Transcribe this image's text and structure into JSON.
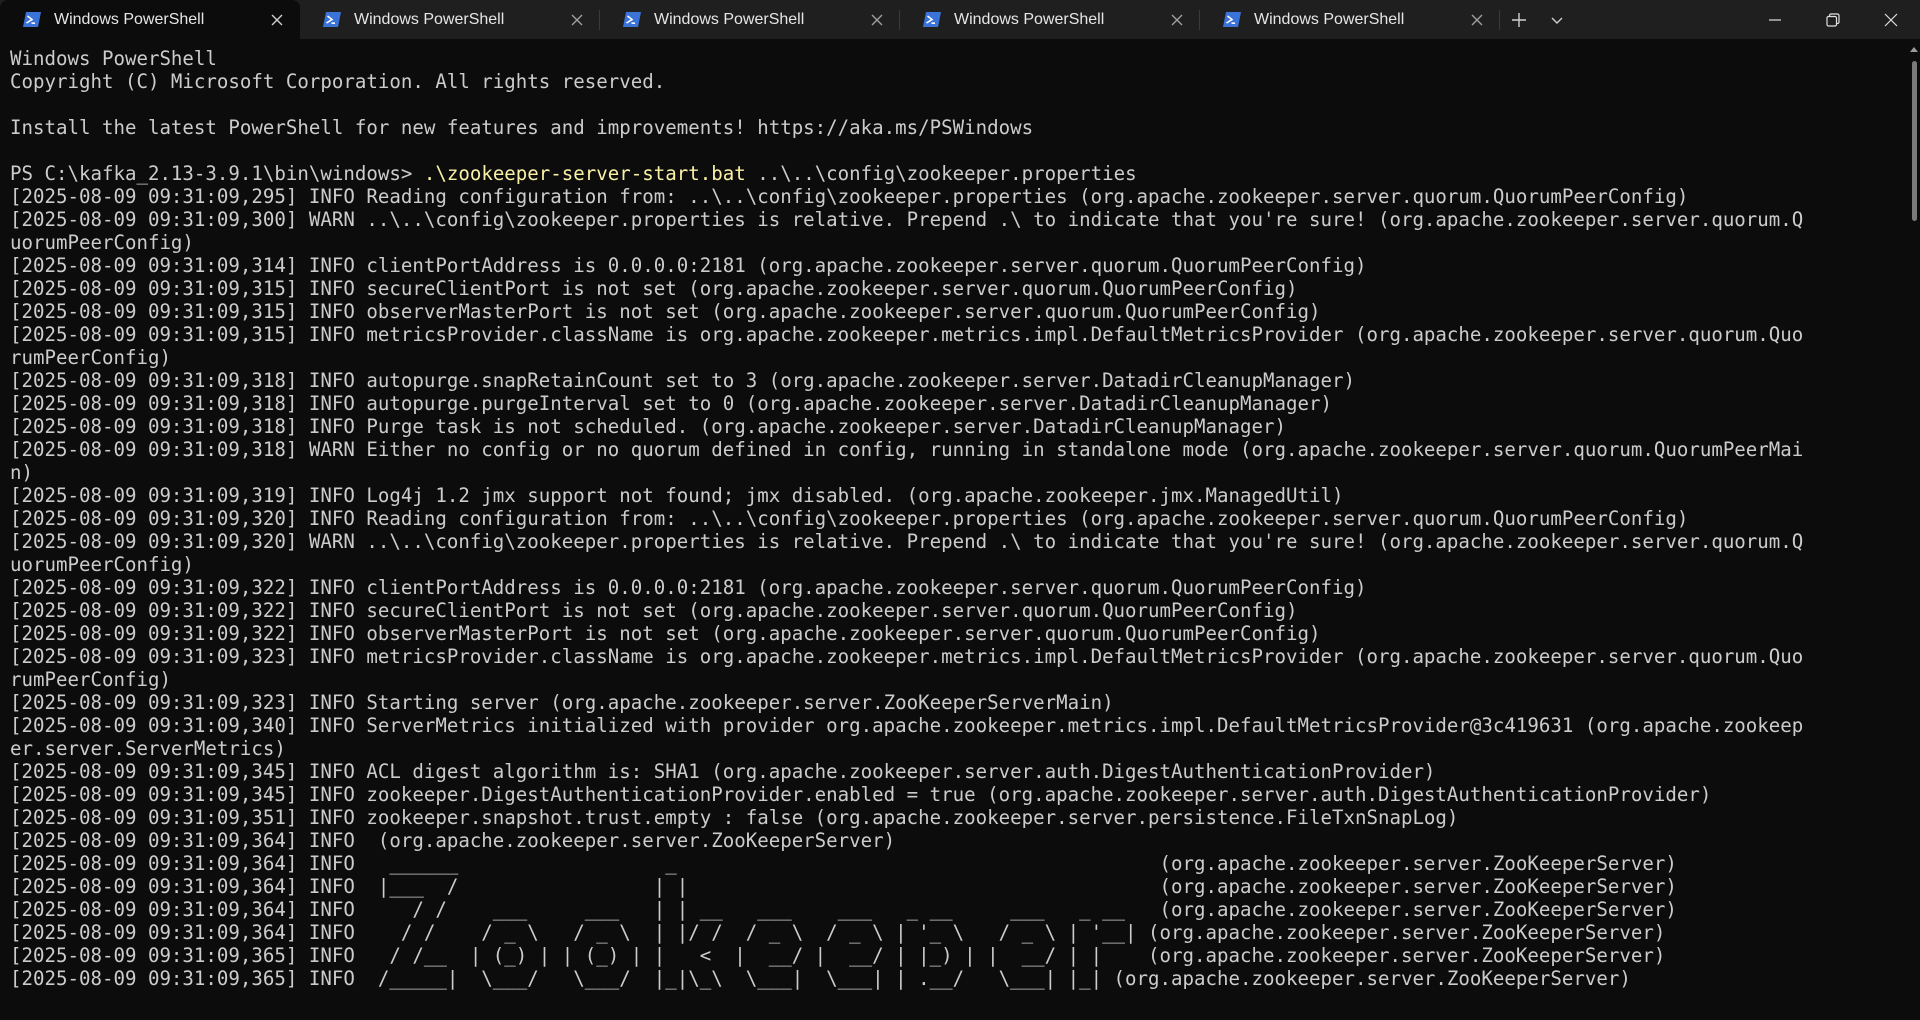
{
  "tabs": [
    {
      "label": "Windows PowerShell",
      "active": true
    },
    {
      "label": "Windows PowerShell",
      "active": false
    },
    {
      "label": "Windows PowerShell",
      "active": false
    },
    {
      "label": "Windows PowerShell",
      "active": false
    },
    {
      "label": "Windows PowerShell",
      "active": false
    }
  ],
  "colors": {
    "background": "#0c0c0c",
    "text": "#cccccc",
    "command": "#f9f1a5",
    "tabbar": "#1f1f1f"
  },
  "terminal": {
    "lines": [
      {
        "text": "Windows PowerShell"
      },
      {
        "text": "Copyright (C) Microsoft Corporation. All rights reserved."
      },
      {
        "text": ""
      },
      {
        "text": "Install the latest PowerShell for new features and improvements! https://aka.ms/PSWindows"
      },
      {
        "text": ""
      },
      {
        "prompt": "PS C:\\kafka_2.13-3.9.1\\bin\\windows> ",
        "command": ".\\zookeeper-server-start.bat",
        "args": " ..\\..\\config\\zookeeper.properties"
      },
      {
        "text": "[2025-08-09 09:31:09,295] INFO Reading configuration from: ..\\..\\config\\zookeeper.properties (org.apache.zookeeper.server.quorum.QuorumPeerConfig)"
      },
      {
        "text": "[2025-08-09 09:31:09,300] WARN ..\\..\\config\\zookeeper.properties is relative. Prepend .\\ to indicate that you're sure! (org.apache.zookeeper.server.quorum.Q"
      },
      {
        "text": "uorumPeerConfig)"
      },
      {
        "text": "[2025-08-09 09:31:09,314] INFO clientPortAddress is 0.0.0.0:2181 (org.apache.zookeeper.server.quorum.QuorumPeerConfig)"
      },
      {
        "text": "[2025-08-09 09:31:09,315] INFO secureClientPort is not set (org.apache.zookeeper.server.quorum.QuorumPeerConfig)"
      },
      {
        "text": "[2025-08-09 09:31:09,315] INFO observerMasterPort is not set (org.apache.zookeeper.server.quorum.QuorumPeerConfig)"
      },
      {
        "text": "[2025-08-09 09:31:09,315] INFO metricsProvider.className is org.apache.zookeeper.metrics.impl.DefaultMetricsProvider (org.apache.zookeeper.server.quorum.Quo"
      },
      {
        "text": "rumPeerConfig)"
      },
      {
        "text": "[2025-08-09 09:31:09,318] INFO autopurge.snapRetainCount set to 3 (org.apache.zookeeper.server.DatadirCleanupManager)"
      },
      {
        "text": "[2025-08-09 09:31:09,318] INFO autopurge.purgeInterval set to 0 (org.apache.zookeeper.server.DatadirCleanupManager)"
      },
      {
        "text": "[2025-08-09 09:31:09,318] INFO Purge task is not scheduled. (org.apache.zookeeper.server.DatadirCleanupManager)"
      },
      {
        "text": "[2025-08-09 09:31:09,318] WARN Either no config or no quorum defined in config, running in standalone mode (org.apache.zookeeper.server.quorum.QuorumPeerMai"
      },
      {
        "text": "n)"
      },
      {
        "text": "[2025-08-09 09:31:09,319] INFO Log4j 1.2 jmx support not found; jmx disabled. (org.apache.zookeeper.jmx.ManagedUtil)"
      },
      {
        "text": "[2025-08-09 09:31:09,320] INFO Reading configuration from: ..\\..\\config\\zookeeper.properties (org.apache.zookeeper.server.quorum.QuorumPeerConfig)"
      },
      {
        "text": "[2025-08-09 09:31:09,320] WARN ..\\..\\config\\zookeeper.properties is relative. Prepend .\\ to indicate that you're sure! (org.apache.zookeeper.server.quorum.Q"
      },
      {
        "text": "uorumPeerConfig)"
      },
      {
        "text": "[2025-08-09 09:31:09,322] INFO clientPortAddress is 0.0.0.0:2181 (org.apache.zookeeper.server.quorum.QuorumPeerConfig)"
      },
      {
        "text": "[2025-08-09 09:31:09,322] INFO secureClientPort is not set (org.apache.zookeeper.server.quorum.QuorumPeerConfig)"
      },
      {
        "text": "[2025-08-09 09:31:09,322] INFO observerMasterPort is not set (org.apache.zookeeper.server.quorum.QuorumPeerConfig)"
      },
      {
        "text": "[2025-08-09 09:31:09,323] INFO metricsProvider.className is org.apache.zookeeper.metrics.impl.DefaultMetricsProvider (org.apache.zookeeper.server.quorum.Quo"
      },
      {
        "text": "rumPeerConfig)"
      },
      {
        "text": "[2025-08-09 09:31:09,323] INFO Starting server (org.apache.zookeeper.server.ZooKeeperServerMain)"
      },
      {
        "text": "[2025-08-09 09:31:09,340] INFO ServerMetrics initialized with provider org.apache.zookeeper.metrics.impl.DefaultMetricsProvider@3c419631 (org.apache.zookeep"
      },
      {
        "text": "er.server.ServerMetrics)"
      },
      {
        "text": "[2025-08-09 09:31:09,345] INFO ACL digest algorithm is: SHA1 (org.apache.zookeeper.server.auth.DigestAuthenticationProvider)"
      },
      {
        "text": "[2025-08-09 09:31:09,345] INFO zookeeper.DigestAuthenticationProvider.enabled = true (org.apache.zookeeper.server.auth.DigestAuthenticationProvider)"
      },
      {
        "text": "[2025-08-09 09:31:09,351] INFO zookeeper.snapshot.trust.empty : false (org.apache.zookeeper.server.persistence.FileTxnSnapLog)"
      },
      {
        "text": "[2025-08-09 09:31:09,364] INFO  (org.apache.zookeeper.server.ZooKeeperServer)"
      },
      {
        "text": "[2025-08-09 09:31:09,364] INFO   ______                  _                                          (org.apache.zookeeper.server.ZooKeeperServer)"
      },
      {
        "text": "[2025-08-09 09:31:09,364] INFO  |___  /                 | |                                         (org.apache.zookeeper.server.ZooKeeperServer)"
      },
      {
        "text": "[2025-08-09 09:31:09,364] INFO     / /    ___     ___   | | __   ___    ___   _ __     ___   _ __   (org.apache.zookeeper.server.ZooKeeperServer)"
      },
      {
        "text": "[2025-08-09 09:31:09,364] INFO    / /    / _ \\   / _ \\  | |/ /  / _ \\  / _ \\ | '_ \\   / _ \\ | '__| (org.apache.zookeeper.server.ZooKeeperServer)"
      },
      {
        "text": "[2025-08-09 09:31:09,365] INFO   / /__  | (_) | | (_) | |   <  |  __/ |  __/ | |_) | |  __/ | |    (org.apache.zookeeper.server.ZooKeeperServer)"
      },
      {
        "text": "[2025-08-09 09:31:09,365] INFO  /_____|  \\___/   \\___/  |_|\\_\\  \\___|  \\___| | .__/   \\___| |_| (org.apache.zookeeper.server.ZooKeeperServer)"
      }
    ]
  }
}
